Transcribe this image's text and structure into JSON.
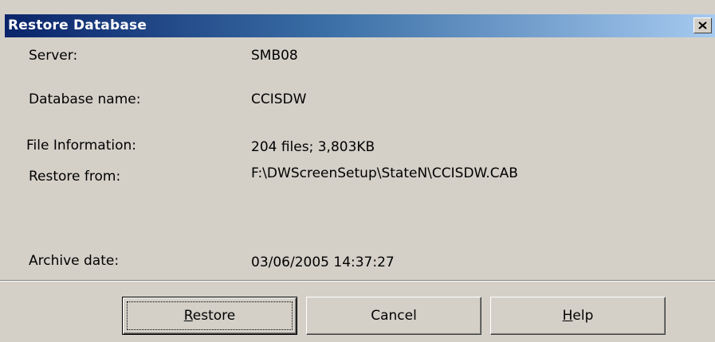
{
  "window": {
    "title": "Restore Database"
  },
  "fields": {
    "server_label": "Server:",
    "server_value": "SMB08",
    "dbname_label": "Database name:",
    "dbname_value": "CCISDW",
    "fileinfo_label": "File Information:",
    "fileinfo_value": "204 files; 3,803KB",
    "restorefrom_label": "Restore from:",
    "restorefrom_value": "F:\\DWScreenSetup\\StateN\\CCISDW.CAB",
    "archivedate_label": "Archive date:",
    "archivedate_value": "03/06/2005 14:37:27"
  },
  "buttons": {
    "restore": {
      "accel": "R",
      "rest": "estore"
    },
    "cancel": {
      "label": "Cancel"
    },
    "help": {
      "accel": "H",
      "rest": "elp"
    }
  },
  "icons": {
    "close": "close-icon"
  },
  "colors": {
    "titlebar_start": "#0a246a",
    "titlebar_end": "#a6caf0",
    "dialog_background": "#d4d0c8"
  }
}
